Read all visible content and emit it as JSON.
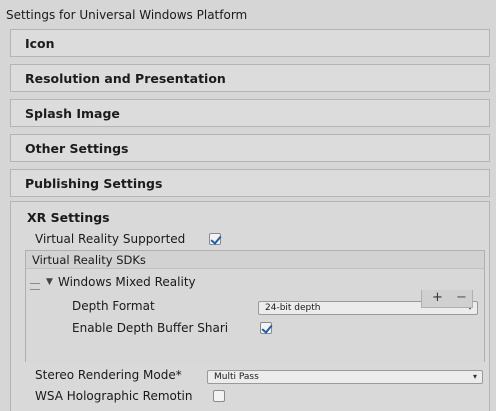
{
  "page_title": "Settings for Universal Windows Platform",
  "sections": [
    {
      "label": "Icon"
    },
    {
      "label": "Resolution and Presentation"
    },
    {
      "label": "Splash Image"
    },
    {
      "label": "Other Settings"
    },
    {
      "label": "Publishing Settings"
    }
  ],
  "xr": {
    "title": "XR Settings",
    "vr_supported_label": "Virtual Reality Supported",
    "vr_supported_checked": true,
    "sdk_list_header": "Virtual Reality SDKs",
    "sdk_item": {
      "name": "Windows Mixed Reality",
      "depth_format_label": "Depth Format",
      "depth_format_value": "24-bit depth",
      "enable_depth_label": "Enable Depth Buffer Shari",
      "enable_depth_checked": true
    },
    "add_symbol": "+",
    "remove_symbol": "−",
    "stereo_label": "Stereo Rendering Mode*",
    "stereo_value": "Multi Pass",
    "holo_label": "WSA Holographic Remotin",
    "holo_checked": false
  },
  "icons": {
    "foldout": "triangle-down-icon",
    "dropdown_arrow": "chevron-down-icon",
    "drag": "drag-handle-icon",
    "checkmark": "checkmark-icon"
  },
  "colors": {
    "check_accent": "#1d5ea8",
    "panel_bg": "#d6d6d6",
    "header_bg": "#dcdcdc"
  }
}
